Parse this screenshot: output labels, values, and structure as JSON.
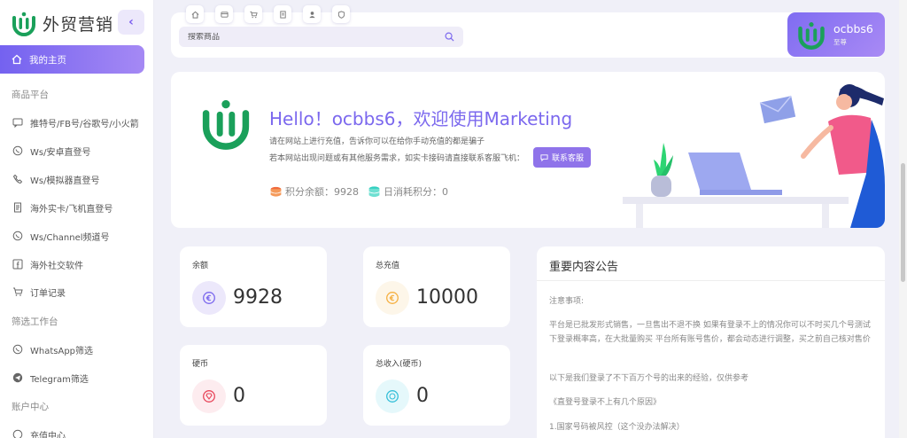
{
  "brand": {
    "name": "外贸营销"
  },
  "sidebar": {
    "active_item": "我的主页",
    "sections": [
      {
        "title": "商品平台",
        "items": [
          "推特号/FB号/谷歌号/小火箭",
          "Ws/安卓直登号",
          "Ws/模拟器直登号",
          "海外实卡/飞机直登号",
          "Ws/Channel频道号",
          "海外社交软件",
          "订单记录"
        ]
      },
      {
        "title": "筛选工作台",
        "items": [
          "WhatsApp筛选",
          "Telegram筛选"
        ]
      },
      {
        "title": "账户中心",
        "items": [
          "充值中心"
        ]
      }
    ]
  },
  "topbar": {
    "quick_tab_icons": [
      "home-icon",
      "card-icon",
      "cart-icon",
      "document-icon",
      "user-icon",
      "shield-icon"
    ],
    "search_placeholder": "搜索商品",
    "user": {
      "name": "ocbbs6",
      "role": "至尊"
    }
  },
  "hero": {
    "title": "Hello！ocbbs6，欢迎使用Marketing",
    "desc1": "请在网站上进行充值，告诉你可以在给你手动充值的都是骗子",
    "desc2": "若本网站出现问题或有其他服务需求，如实卡接码请直接联系客服飞机：",
    "contact_label": "联系客服",
    "points_balance_label": "积分余额：",
    "points_balance": "9928",
    "daily_points_label": "日消耗积分：",
    "daily_points": "0"
  },
  "cards": {
    "balance": {
      "label": "余额",
      "value": "9928"
    },
    "total_recharge": {
      "label": "总充值",
      "value": "10000"
    },
    "coins": {
      "label": "硬币",
      "value": "0"
    },
    "total_income": {
      "label": "总收入(硬币)",
      "value": "0"
    }
  },
  "notice": {
    "title": "重要内容公告",
    "p1": "注意事项:",
    "p2": "平台是已批发形式销售，一旦售出不退不换 如果有登录不上的情况你可以不时买几个号测试下登录概率高，在大批量购买 平台所有账号售价，都会动态进行调整，买之前自己核对售价",
    "p3": "以下是我们登录了不下百万个号的出来的经验，仅供参考",
    "p4": "《直登号登录不上有几个原因》",
    "p5": "1.国家号码被风控（这个没办法解决）"
  },
  "colors": {
    "accent": "#7b68ee",
    "brand_green": "#1aa05a"
  }
}
